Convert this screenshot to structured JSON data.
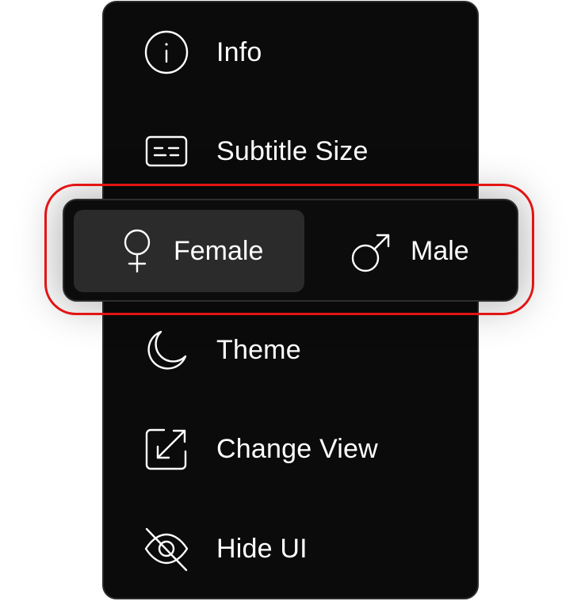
{
  "menu": {
    "items": [
      {
        "id": "info",
        "label": "Info",
        "icon": "info-icon"
      },
      {
        "id": "subtitle-size",
        "label": "Subtitle Size",
        "icon": "subtitles-icon"
      },
      {
        "id": "theme",
        "label": "Theme",
        "icon": "moon-icon"
      },
      {
        "id": "change-view",
        "label": "Change View",
        "icon": "resize-arrow-icon"
      },
      {
        "id": "hide-ui",
        "label": "Hide UI",
        "icon": "eye-off-icon"
      }
    ]
  },
  "gender_toggle": {
    "options": [
      {
        "id": "female",
        "label": "Female",
        "icon": "female-symbol-icon",
        "selected": true
      },
      {
        "id": "male",
        "label": "Male",
        "icon": "male-symbol-icon",
        "selected": false
      }
    ]
  },
  "colors": {
    "panel_background": "#0b0b0b",
    "selected_option_background": "#2b2b2b",
    "text": "#ffffff",
    "highlight": "#e31414"
  }
}
